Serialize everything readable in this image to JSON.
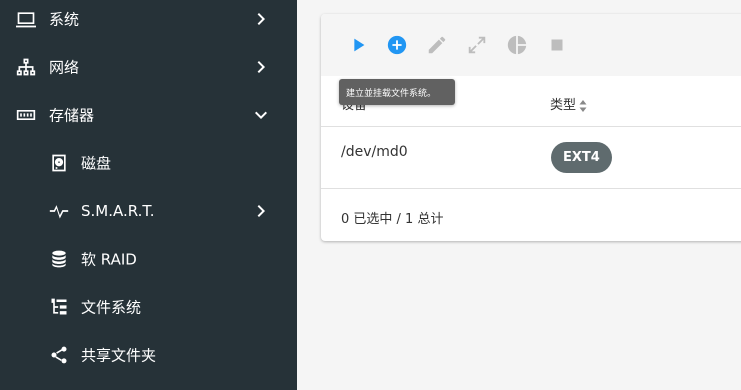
{
  "sidebar": {
    "items": [
      {
        "label": "系统",
        "icon": "monitor-icon",
        "expandable": true,
        "expanded": false
      },
      {
        "label": "网络",
        "icon": "network-icon",
        "expandable": true,
        "expanded": false
      },
      {
        "label": "存储器",
        "icon": "storage-icon",
        "expandable": true,
        "expanded": true
      },
      {
        "label": "磁盘",
        "icon": "harddisk-icon",
        "sub": true
      },
      {
        "label": "S.M.A.R.T.",
        "icon": "pulse-icon",
        "sub": true,
        "expandable": true,
        "expanded": false
      },
      {
        "label": "软 RAID",
        "icon": "database-icon",
        "sub": true
      },
      {
        "label": "文件系统",
        "icon": "file-tree-icon",
        "sub": true
      },
      {
        "label": "共享文件夹",
        "icon": "share-icon",
        "sub": true
      }
    ]
  },
  "toolbar": {
    "buttons": [
      {
        "icon": "play-icon",
        "name": "mount",
        "enabled": true,
        "color": "#2196f3"
      },
      {
        "icon": "plus-circle-icon",
        "name": "create-and-mount",
        "enabled": true,
        "color": "#2196f3"
      },
      {
        "icon": "pencil-icon",
        "name": "edit",
        "enabled": false,
        "color": "#bdbdbd"
      },
      {
        "icon": "expand-icon",
        "name": "resize",
        "enabled": false,
        "color": "#bdbdbd"
      },
      {
        "icon": "pie-chart-icon",
        "name": "quota",
        "enabled": false,
        "color": "#bdbdbd"
      },
      {
        "icon": "stop-icon",
        "name": "unmount",
        "enabled": false,
        "color": "#bdbdbd"
      }
    ],
    "tooltip": "建立並挂载文件系统。"
  },
  "table": {
    "columns": [
      "设备",
      "类型"
    ],
    "rows": [
      {
        "device": "/dev/md0",
        "type": "EXT4"
      }
    ],
    "footer": "0 已选中 / 1 总计"
  },
  "colors": {
    "sidebar_bg": "#263238",
    "accent": "#2196f3",
    "badge_bg": "#5f6b6e"
  }
}
